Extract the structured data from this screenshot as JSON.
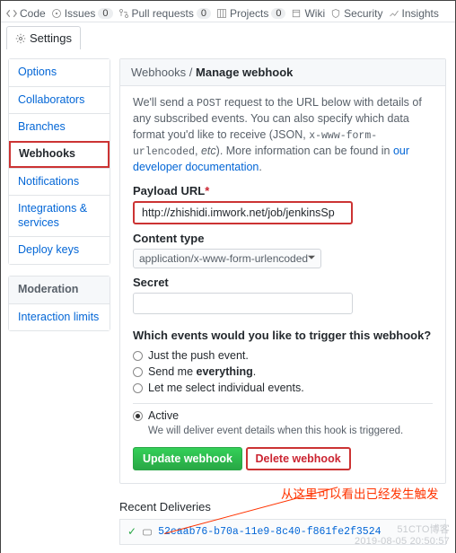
{
  "topnav": {
    "code": "Code",
    "issues": "Issues",
    "issues_count": "0",
    "pulls": "Pull requests",
    "pulls_count": "0",
    "projects": "Projects",
    "projects_count": "0",
    "wiki": "Wiki",
    "security": "Security",
    "insights": "Insights"
  },
  "tab": {
    "settings": "Settings"
  },
  "sidebar": {
    "options": "Options",
    "collaborators": "Collaborators",
    "branches": "Branches",
    "webhooks": "Webhooks",
    "notifications": "Notifications",
    "integrations": "Integrations & services",
    "deploy": "Deploy keys",
    "moderation": "Moderation",
    "interaction": "Interaction limits"
  },
  "panel": {
    "crumb": "Webhooks / ",
    "title": "Manage webhook",
    "intro1": "We'll send a ",
    "post": "POST",
    "intro2": " request to the URL below with details of any subscribed events. You can also specify which data format you'd like to receive (JSON, ",
    "code_fmt": "x-www-form-urlencoded",
    "intro3": ", ",
    "etc": "etc",
    "intro4": "). More information can be found in ",
    "doc_link": "our developer documentation",
    "dot": "."
  },
  "form": {
    "payload_label": "Payload URL",
    "payload_required": "*",
    "payload_value": "http://zhishidi.imwork.net/job/jenkinsSp",
    "ct_label": "Content type",
    "ct_value": "application/x-www-form-urlencoded",
    "secret_label": "Secret",
    "secret_value": "",
    "events_q": "Which events would you like to trigger this webhook?",
    "opt_push": "Just the push event.",
    "opt_everything_1": "Send me ",
    "opt_everything_2": "everything",
    "opt_everything_3": ".",
    "opt_individual": "Let me select individual events.",
    "active": "Active",
    "active_note": "We will deliver event details when this hook is triggered.",
    "update_btn": "Update webhook",
    "delete_btn": "Delete webhook"
  },
  "recent": {
    "title": "Recent Deliveries",
    "id": "52caab76-b70a-11e9-8c40-f861fe2f3524"
  },
  "annotation": "从这里可以看出已经发生触发",
  "watermark1": "51CTO博客",
  "watermark2": "2019-08-05 20:50:57"
}
